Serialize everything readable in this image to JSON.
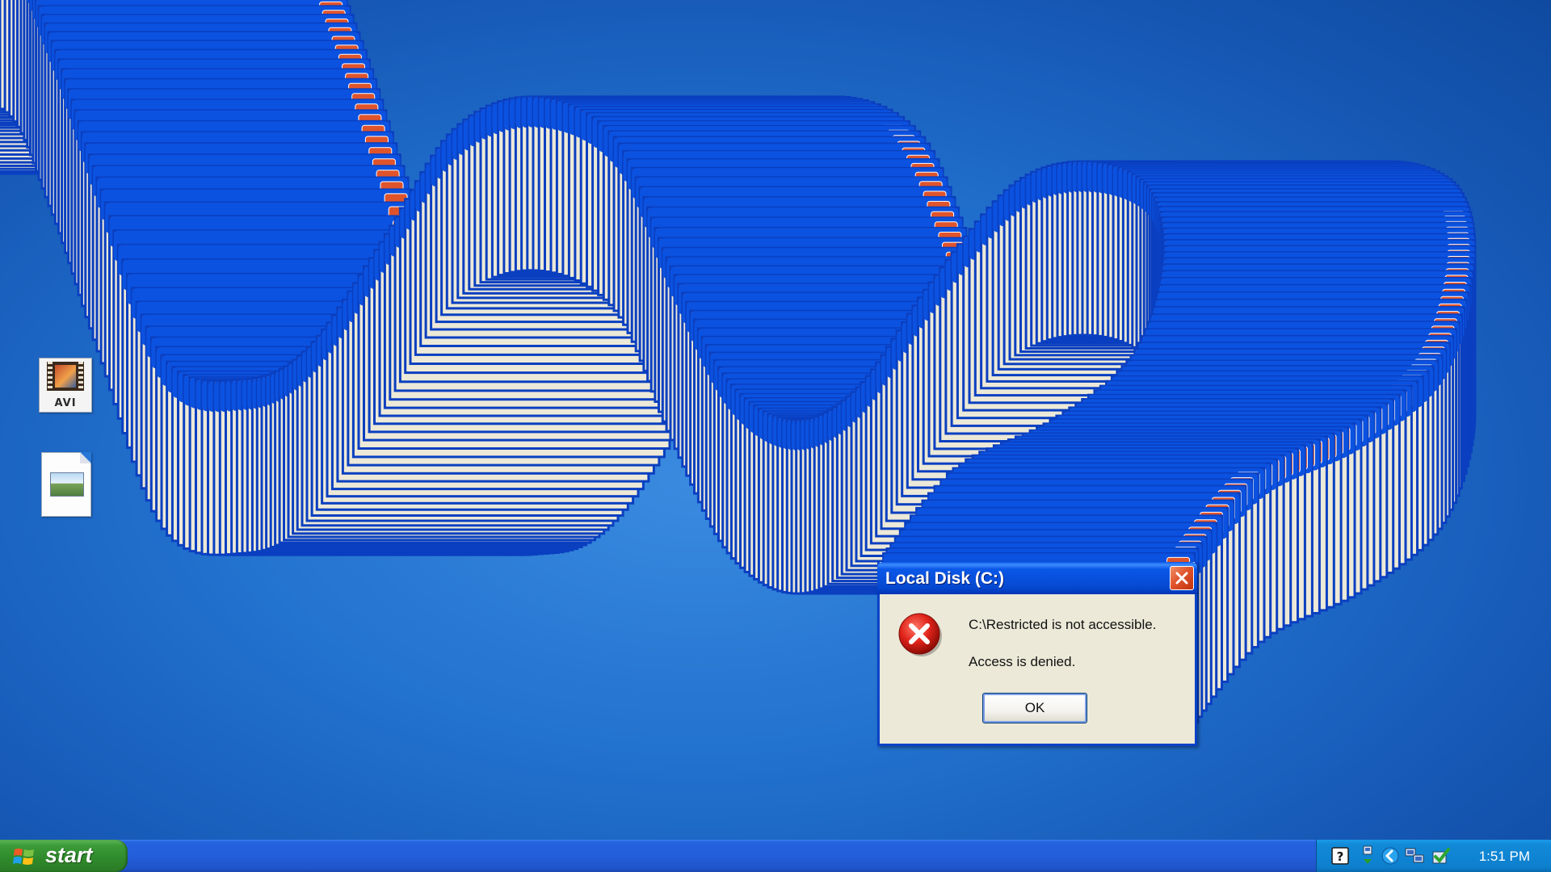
{
  "desktop": {
    "icons": [
      {
        "name": "avi-file",
        "label": "AVI"
      },
      {
        "name": "image-file",
        "label": ""
      }
    ]
  },
  "dialog": {
    "title": "Local Disk (C:)",
    "message_line1": "C:\\Restricted is not accessible.",
    "message_line2": "Access is denied.",
    "ok_label": "OK",
    "icon": "error-icon",
    "close_icon": "close-icon"
  },
  "taskbar": {
    "start_label": "start",
    "clock": "1:51 PM",
    "tray_icons": [
      "help-icon",
      "safely-remove-hardware-icon",
      "back-arrow-icon",
      "network-icon",
      "security-check-icon"
    ]
  },
  "colors": {
    "desktop_blue": "#2272cf",
    "titlebar_blue": "#0548d0",
    "dialog_face": "#ece9d8",
    "close_red": "#e0542c",
    "start_green": "#3c9b38",
    "tray_blue": "#0d7fcd"
  }
}
